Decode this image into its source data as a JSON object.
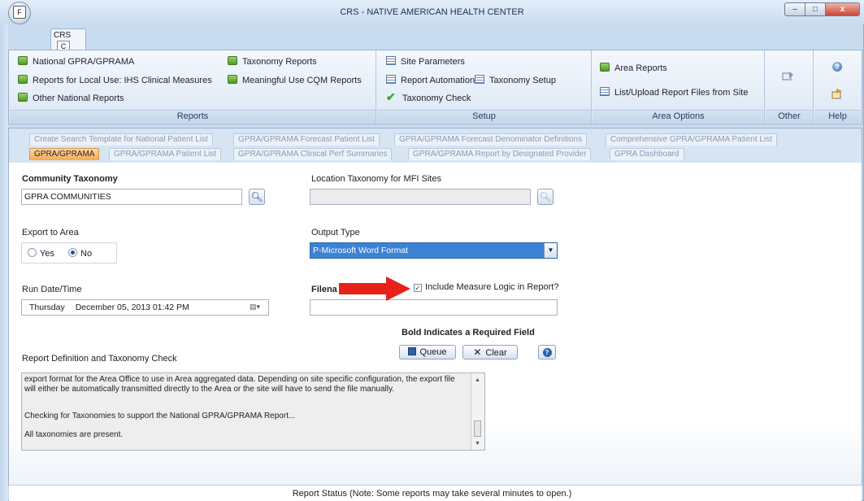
{
  "window": {
    "title": "CRS - NATIVE AMERICAN HEALTH CENTER",
    "app_button_key": "F",
    "controls": {
      "minimize": "–",
      "maximize": "□",
      "close": "x"
    }
  },
  "ribbon_tab": {
    "label": "CRS",
    "key_tip": "C"
  },
  "ribbon": {
    "reports": {
      "label": "Reports",
      "items": [
        "National GPRA/GPRAMA",
        "Reports for Local Use: IHS Clinical Measures",
        "Other National Reports",
        "Taxonomy Reports",
        "Meaningful Use CQM Reports"
      ]
    },
    "setup": {
      "label": "Setup",
      "items": [
        "Site Parameters",
        "Report Automation",
        "Taxonomy Setup",
        "Taxonomy Check"
      ]
    },
    "area_options": {
      "label": "Area Options",
      "items": [
        "Area Reports",
        "List/Upload Report Files from Site"
      ]
    },
    "other": {
      "label": "Other"
    },
    "help": {
      "label": "Help"
    }
  },
  "tabs": {
    "row1": [
      "Create Search Template for National Patient List",
      "GPRA/GPRAMA Forecast Patient List",
      "GPRA/GPRAMA Forecast Denominator Definitions",
      "Comprehensive GPRA/GPRAMA Patient List"
    ],
    "row2": [
      "GPRA/GPRAMA",
      "GPRA/GPRAMA Patient List",
      "GPRA/GPRAMA Clinical Perf Summaries",
      "GPRA/GPRAMA Report by Designated Provider",
      "GPRA Dashboard"
    ],
    "active": "GPRA/GPRAMA"
  },
  "form": {
    "community_taxonomy": {
      "label": "Community Taxonomy",
      "value": "GPRA COMMUNITIES"
    },
    "location_taxonomy": {
      "label": "Location Taxonomy for MFI Sites",
      "value": ""
    },
    "export_to_area": {
      "label": "Export to Area",
      "options": [
        "Yes",
        "No"
      ],
      "selected": "No"
    },
    "output_type": {
      "label": "Output Type",
      "value": "P-Microsoft Word Format"
    },
    "run_datetime": {
      "label": "Run Date/Time",
      "day": "Thursday",
      "date": "December 05, 2013  01:42 PM"
    },
    "filename": {
      "label": "Filena",
      "value": ""
    },
    "include_logic": {
      "label": "Include Measure Logic in Report?",
      "checked": true
    },
    "required_note": "Bold Indicates a Required Field",
    "queue_label": "Queue",
    "clear_label": "Clear",
    "report_def_label": "Report Definition and Taxonomy Check",
    "report_text": [
      "export format for the Area Office to use in Area aggregated data. Depending on site specific configuration, the export file will either be automatically transmitted directly to the Area or the site will have to send the file manually.",
      "Checking for Taxonomies to support the National GPRA/GPRAMA Report...",
      "All taxonomies are present."
    ]
  },
  "status": {
    "text": "Report Status   (Note: Some reports may take several minutes to open.)"
  },
  "colors": {
    "active_tab": "#f6a94d",
    "selection": "#3c83d6",
    "arrow": "#e8211b"
  }
}
